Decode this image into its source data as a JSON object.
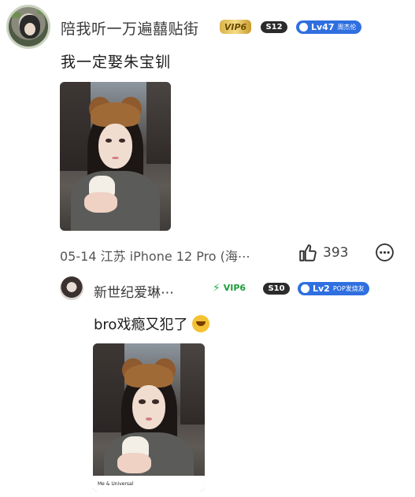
{
  "comment": {
    "username": "陪我听一万遍囍贴街",
    "badges": {
      "gold": "VIP6",
      "fans_level": "S12",
      "level": "Lv47",
      "level_tag": "周杰伦"
    },
    "text": "我一定娶朱宝钏",
    "meta": "05-14 江苏 iPhone 12 Pro (海⋯",
    "likes": "393"
  },
  "reply": {
    "username": "新世纪爱琳⋯",
    "badges": {
      "vip": "VIP6",
      "fans_level": "S10",
      "level": "Lv2",
      "level_tag": "POP发烧友"
    },
    "text": "bro戏瘾又犯了",
    "photo_caption": "Me & Universal"
  },
  "icons": {
    "like": "thumbs-up-icon",
    "more": "more-dots-icon",
    "vip": "lightning-icon"
  },
  "colors": {
    "level_badge": "#2f6fe0",
    "vip_green": "#1f9e3a",
    "gold": "#d9b347"
  }
}
